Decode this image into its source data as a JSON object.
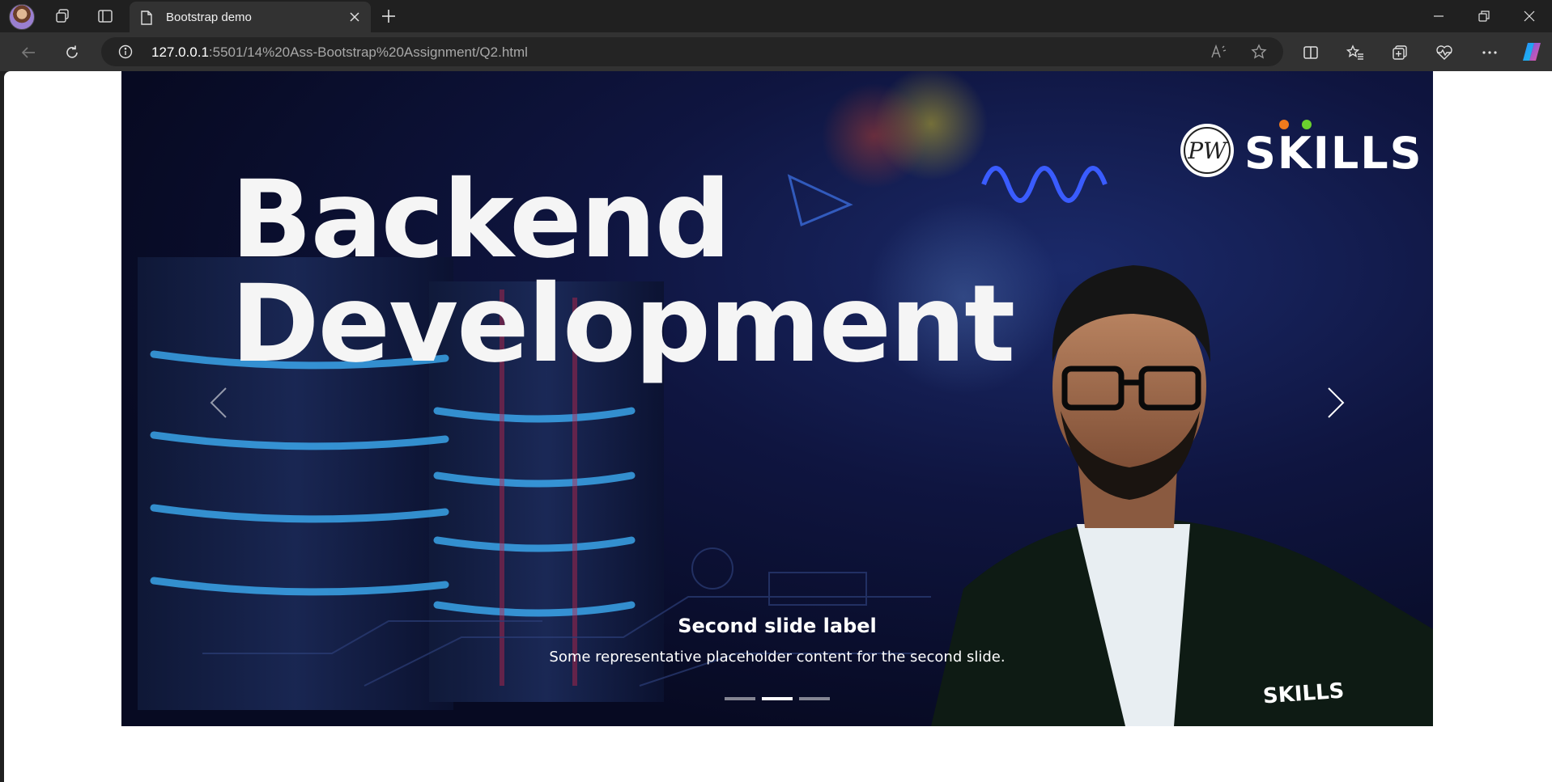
{
  "browser": {
    "tab": {
      "title": "Bootstrap demo"
    },
    "address": {
      "host": "127.0.0.1",
      "path": ":5501/14%20Ass-Bootstrap%20Assignment/Q2.html"
    }
  },
  "slide": {
    "headline_line1": "Backend",
    "headline_line2": "Development",
    "brand_word": "SKILLS",
    "brand_mark": "PW",
    "badge_word": "SKILLS"
  },
  "carousel": {
    "caption_title": "Second slide label",
    "caption_text": "Some representative placeholder content for the second slide.",
    "indicators": [
      {
        "active": false
      },
      {
        "active": true
      },
      {
        "active": false
      }
    ]
  },
  "colors": {
    "browser_frame": "#202020",
    "toolbar": "#323232",
    "slide_bg": "#0f1540"
  }
}
